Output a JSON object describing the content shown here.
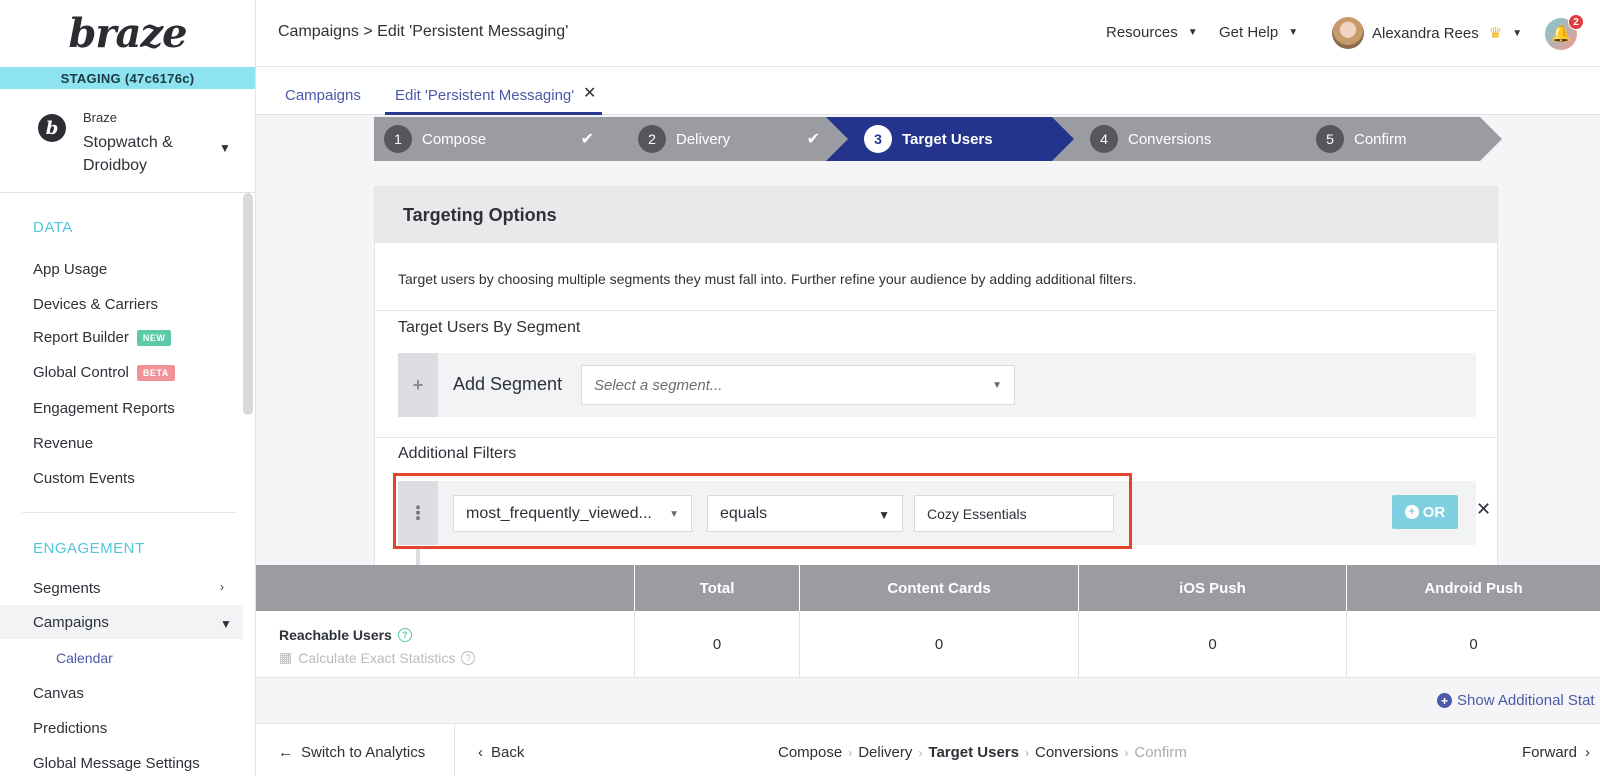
{
  "sidebar": {
    "logo": "braze",
    "staging": "STAGING (47c6176c)",
    "workspace_small": "Braze",
    "workspace_name": "Stopwatch & Droidboy",
    "sections": {
      "data": "DATA",
      "engagement": "ENGAGEMENT"
    },
    "data_items": [
      {
        "label": "App Usage"
      },
      {
        "label": "Devices & Carriers"
      },
      {
        "label": "Report Builder",
        "badge": "NEW"
      },
      {
        "label": "Global Control",
        "badge": "BETA"
      },
      {
        "label": "Engagement Reports"
      },
      {
        "label": "Revenue"
      },
      {
        "label": "Custom Events"
      }
    ],
    "engagement_items": [
      {
        "label": "Segments"
      },
      {
        "label": "Campaigns"
      },
      {
        "label": "Calendar"
      },
      {
        "label": "Canvas"
      },
      {
        "label": "Predictions"
      },
      {
        "label": "Global Message Settings"
      }
    ]
  },
  "topbar": {
    "breadcrumb": "Campaigns > Edit 'Persistent Messaging'",
    "resources": "Resources",
    "get_help": "Get Help",
    "user_name": "Alexandra Rees",
    "notification_count": "2"
  },
  "tabs": {
    "campaigns": "Campaigns",
    "edit": "Edit 'Persistent Messaging'"
  },
  "steps": [
    {
      "num": "1",
      "label": "Compose",
      "done": true
    },
    {
      "num": "2",
      "label": "Delivery",
      "done": true
    },
    {
      "num": "3",
      "label": "Target Users",
      "active": true
    },
    {
      "num": "4",
      "label": "Conversions"
    },
    {
      "num": "5",
      "label": "Confirm"
    }
  ],
  "targeting": {
    "title": "Targeting Options",
    "description": "Target users by choosing multiple segments they must fall into. Further refine your audience by adding additional filters.",
    "segment_section": "Target Users By Segment",
    "add_segment": "Add Segment",
    "segment_placeholder": "Select a segment...",
    "filters_section": "Additional Filters",
    "filter_attribute": "most_frequently_viewed...",
    "filter_operator": "equals",
    "filter_value": "Cozy Essentials",
    "or_label": "OR"
  },
  "stats": {
    "columns": [
      "Total",
      "Content Cards",
      "iOS Push",
      "Android Push"
    ],
    "values": [
      "0",
      "0",
      "0",
      "0"
    ],
    "reachable_users": "Reachable Users",
    "calc_exact": "Calculate Exact Statistics",
    "show_additional": "Show Additional Stat"
  },
  "footer": {
    "switch_analytics": "Switch to Analytics",
    "back": "Back",
    "crumbs": [
      "Compose",
      "Delivery",
      "Target Users",
      "Conversions",
      "Confirm"
    ],
    "forward": "Forward"
  }
}
